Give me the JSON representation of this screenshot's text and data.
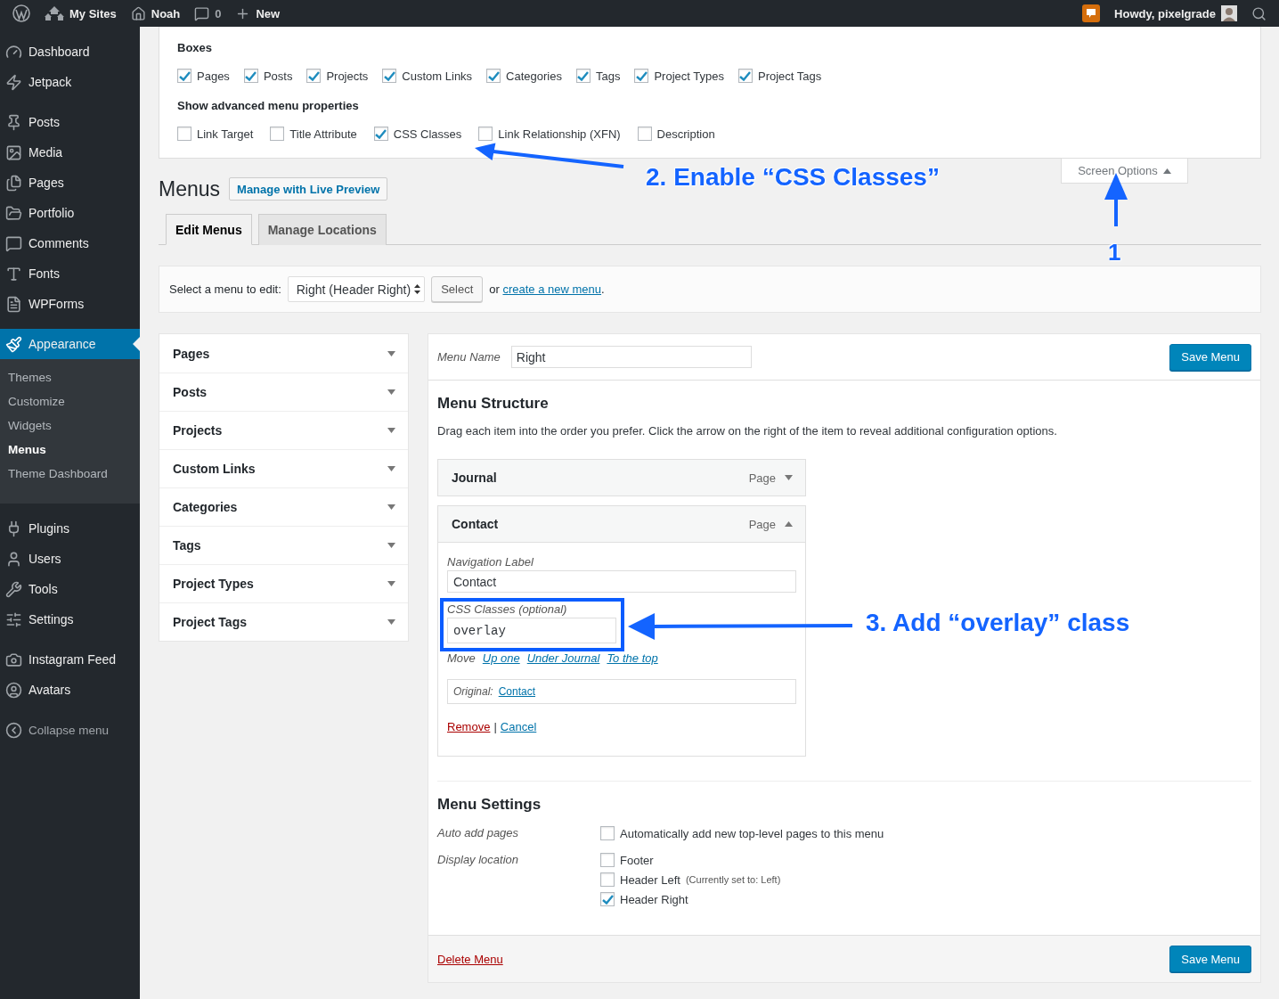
{
  "admin_bar": {
    "items": [
      {
        "label": "My Sites"
      },
      {
        "label": "Noah"
      },
      {
        "label": "0"
      },
      {
        "label": "New"
      }
    ],
    "greeting": "Howdy, pixelgrade"
  },
  "sidebar": {
    "groups": [
      [
        {
          "label": "Dashboard",
          "selected": false
        },
        {
          "label": "Jetpack",
          "selected": false
        }
      ],
      [
        {
          "label": "Posts",
          "selected": false
        },
        {
          "label": "Media",
          "selected": false
        },
        {
          "label": "Pages",
          "selected": false
        },
        {
          "label": "Portfolio",
          "selected": false
        },
        {
          "label": "Comments",
          "selected": false
        },
        {
          "label": "Fonts",
          "selected": false
        },
        {
          "label": "WPForms",
          "selected": false
        }
      ],
      [
        {
          "label": "Appearance",
          "selected": true,
          "children": [
            {
              "label": "Themes",
              "selected": false
            },
            {
              "label": "Customize",
              "selected": false
            },
            {
              "label": "Widgets",
              "selected": false
            },
            {
              "label": "Menus",
              "selected": true
            },
            {
              "label": "Theme Dashboard",
              "selected": false
            }
          ]
        }
      ],
      [
        {
          "label": "Plugins",
          "selected": false
        },
        {
          "label": "Users",
          "selected": false
        },
        {
          "label": "Tools",
          "selected": false
        },
        {
          "label": "Settings",
          "selected": false
        }
      ],
      [
        {
          "label": "Instagram Feed",
          "selected": false
        },
        {
          "label": "Avatars",
          "selected": false
        }
      ]
    ],
    "collapse": "Collapse menu"
  },
  "screen_options": {
    "expanded": true,
    "toggle": "Screen Options",
    "boxes_title": "Boxes",
    "boxes": [
      {
        "label": "Pages",
        "checked": true
      },
      {
        "label": "Posts",
        "checked": true
      },
      {
        "label": "Projects",
        "checked": true
      },
      {
        "label": "Custom Links",
        "checked": true
      },
      {
        "label": "Categories",
        "checked": true
      },
      {
        "label": "Tags",
        "checked": true
      },
      {
        "label": "Project Types",
        "checked": true
      },
      {
        "label": "Project Tags",
        "checked": true
      }
    ],
    "advanced_title": "Show advanced menu properties",
    "advanced": [
      {
        "label": "Link Target",
        "checked": false
      },
      {
        "label": "Title Attribute",
        "checked": false
      },
      {
        "label": "CSS Classes",
        "checked": true
      },
      {
        "label": "Link Relationship (XFN)",
        "checked": false
      },
      {
        "label": "Description",
        "checked": false
      }
    ]
  },
  "page": {
    "title": "Menus",
    "action": "Manage with Live Preview"
  },
  "tabs": [
    {
      "label": "Edit Menus",
      "selected": true
    },
    {
      "label": "Manage Locations",
      "selected": false
    }
  ],
  "menu_select": {
    "label": "Select a menu to edit:",
    "value": "Right (Header Right)",
    "button": "Select",
    "prefix": "or",
    "link": "create a new menu",
    "suffix": "."
  },
  "sections": [
    {
      "label": "Pages",
      "expanded": false
    },
    {
      "label": "Posts",
      "expanded": false
    },
    {
      "label": "Projects",
      "expanded": false
    },
    {
      "label": "Custom Links",
      "expanded": false
    },
    {
      "label": "Categories",
      "expanded": false
    },
    {
      "label": "Tags",
      "expanded": false
    },
    {
      "label": "Project Types",
      "expanded": false
    },
    {
      "label": "Project Tags",
      "expanded": false
    }
  ],
  "menu_editor": {
    "name_label": "Menu Name",
    "name_value": "Right",
    "save": "Save Menu",
    "structure_title": "Menu Structure",
    "structure_hint": "Drag each item into the order you prefer. Click the arrow on the right of the item to reveal additional configuration options.",
    "items": [
      {
        "title": "Journal",
        "type": "Page",
        "expanded": false
      },
      {
        "title": "Contact",
        "type": "Page",
        "expanded": true,
        "settings": {
          "nav_label": "Navigation Label",
          "nav_value": "Contact",
          "css_label": "CSS Classes (optional)",
          "css_value": "overlay",
          "move_label": "Move",
          "move_links": [
            "Up one",
            "Under Journal",
            "To the top"
          ],
          "original_label": "Original:",
          "original_link": "Contact",
          "remove": "Remove",
          "separator": "|",
          "cancel": "Cancel"
        }
      }
    ],
    "settings_title": "Menu Settings",
    "setting_rows": [
      {
        "label": "Auto add pages",
        "options": [
          {
            "label": "Automatically add new top-level pages to this menu",
            "checked": false
          }
        ]
      },
      {
        "label": "Display location",
        "options": [
          {
            "label": "Footer",
            "checked": false
          },
          {
            "label": "Header Left",
            "note": "(Currently set to: Left)",
            "checked": false
          },
          {
            "label": "Header Right",
            "checked": true
          }
        ]
      }
    ],
    "delete": "Delete Menu",
    "save_bottom": "Save Menu"
  },
  "annotations": [
    {
      "text": "2. Enable “CSS Classes”"
    },
    {
      "text": "1"
    },
    {
      "text": "3. Add “overlay” class"
    }
  ]
}
